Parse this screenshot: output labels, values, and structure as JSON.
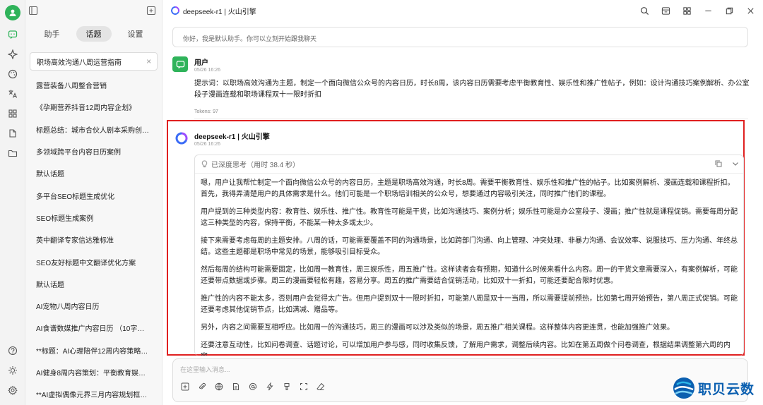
{
  "window": {
    "title": "deepseek-r1 | 火山引擎"
  },
  "sidebar": {
    "tabs": [
      {
        "label": "助手"
      },
      {
        "label": "话题"
      },
      {
        "label": "设置"
      }
    ],
    "active_tab": "话题",
    "topics": [
      "职场高效沟通八周运营指南",
      "露营装备八周整合营销",
      "《孕期营养抖音12周内容企划》",
      "标题总结：城市合伙人剧本采购创业...",
      "多领域跨平台内容日历案例",
      "默认话题",
      "多平台SEO标题生成优化",
      "SEO标题生成案例",
      "英中翻译专家信达雅标准",
      "SEO友好标题中文翻译优化方案",
      "默认话题",
      "AI宠物八周内容日历",
      "AI食谱数媒推广内容日历 （10字，中...",
      "**标题：AI心理陪伴12周内容策略规...",
      "AI健身8周内容策划：平衡教育娱乐营销",
      "**AI虚拟偶像元界三月内容规划框架*..."
    ]
  },
  "chat": {
    "system_message": "你好，我是默认助手。你可以立刻开始跟我聊天",
    "user": {
      "name": "用户",
      "time": "05/26 16:26",
      "text": "提示词：以职场高效沟通为主题，制定一个面向微信公众号的内容日历，时长8周，该内容日历需要考虑平衡教育性、娱乐性和推广性帖子，例如：设计沟通技巧案例解析、办公室段子漫画连载和职场课程双十一限时折扣",
      "tokens": "Tokens: 97"
    },
    "bot": {
      "name": "deepseek-r1 | 火山引擎",
      "time": "05/26 16:26",
      "thinking_label": "已深度思考（用时 38.4 秒）",
      "paragraphs": [
        "嗯，用户让我帮忙制定一个面向微信公众号的内容日历，主题是职场高效沟通，时长8周。需要平衡教育性、娱乐性和推广性的帖子。比如案例解析、漫画连载和课程折扣。首先，我得弄清楚用户的具体需求是什么。他们可能是一个职场培训相关的公众号，想要通过内容吸引关注，同时推广他们的课程。",
        "用户提到的三种类型内容：教育性、娱乐性、推广性。教育性可能是干货，比如沟通技巧、案例分析；娱乐性可能是办公室段子、漫画；推广性就是课程促销。需要每周分配这三种类型的内容，保持平衡，不能某一种太多或太少。",
        "接下来需要考虑每周的主题安排。八周的话，可能需要覆盖不同的沟通场景，比如跨部门沟通、向上管理、冲突处理、非暴力沟通、会议效率、说服技巧、压力沟通、年终总结。这些主题都是职场中常见的场景，能够吸引目标受众。",
        "然后每周的结构可能需要固定，比如周一教育性，周三娱乐性，周五推广性。这样读者会有预期，知道什么时候来看什么内容。周一的干货文章需要深入，有案例解析，可能还要带点数据或步骤。周三的漫画要轻松有趣，容易分享。周五的推广需要结合促销活动，比如双十一折扣，可能还要配合限时优惠。",
        "推广性的内容不能太多，否则用户会觉得太广告。但用户提到双十一限时折扣，可能第八周是双十一当周，所以需要提前预热，比如第七周开始预告，第八周正式促销。可能还要考虑其他促销节点，比如满减、赠品等。",
        "另外，内容之间需要互相呼应。比如周一的沟通技巧，周三的漫画可以涉及类似的场景，周五推广相关课程。这样整体内容更连贯，也能加强推广效果。",
        "还要注意互动性，比如问卷调查、话题讨论，可以增加用户参与感，同时收集反馈，了解用户需求，调整后续内容。比如在第五周做个问卷调查，根据结果调整第六周的内容。"
      ]
    }
  },
  "input": {
    "placeholder": "在这里输入消息..."
  },
  "watermark": {
    "text": "职贝云数"
  },
  "colors": {
    "accent": "#2fb35a",
    "highlight_frame": "#e02020",
    "watermark": "#0a5fb0"
  }
}
